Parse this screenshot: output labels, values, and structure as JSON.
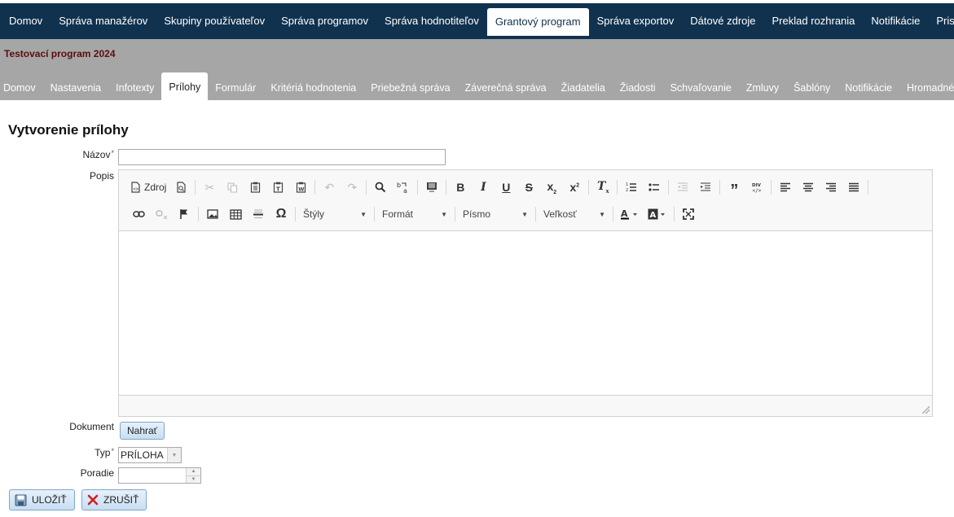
{
  "top_nav": {
    "items": [
      {
        "label": "Domov"
      },
      {
        "label": "Správa manažérov"
      },
      {
        "label": "Skupiny používateľov"
      },
      {
        "label": "Správa programov"
      },
      {
        "label": "Správa hodnotiteľov"
      },
      {
        "label": "Grantový program",
        "active": true
      },
      {
        "label": "Správa exportov"
      },
      {
        "label": "Dátové zdroje"
      },
      {
        "label": "Preklad rozhrania"
      },
      {
        "label": "Notifikácie"
      },
      {
        "label": "Prispôsobené texty"
      }
    ]
  },
  "program": {
    "title": "Testovací program 2024"
  },
  "sub_nav": {
    "items": [
      {
        "label": "Domov"
      },
      {
        "label": "Nastavenia"
      },
      {
        "label": "Infotexty"
      },
      {
        "label": "Prílohy",
        "active": true
      },
      {
        "label": "Formulár"
      },
      {
        "label": "Kritériá hodnotenia"
      },
      {
        "label": "Priebežná správa"
      },
      {
        "label": "Záverečná správa"
      },
      {
        "label": "Žiadatelia"
      },
      {
        "label": "Žiadosti"
      },
      {
        "label": "Schvaľovanie"
      },
      {
        "label": "Zmluvy"
      },
      {
        "label": "Šablóny"
      },
      {
        "label": "Notifikácie"
      },
      {
        "label": "Hromadné notifikácie"
      }
    ]
  },
  "page": {
    "title": "Vytvorenie prílohy"
  },
  "form": {
    "nazov_label": "Názov",
    "nazov_value": "",
    "popis_label": "Popis",
    "dokument_label": "Dokument",
    "upload_label": "Nahrať",
    "typ_label": "Typ",
    "typ_value": "PRÍLOHA",
    "poradie_label": "Poradie",
    "poradie_value": "",
    "required_mark": "*"
  },
  "editor": {
    "source_label": "Zdroj",
    "styles_label": "Štýly",
    "format_label": "Formát",
    "font_label": "Písmo",
    "size_label": "Veľkosť"
  },
  "actions": {
    "save_label": "ULOŽIŤ",
    "cancel_label": "ZRUŠIŤ"
  },
  "colors": {
    "top_nav_bg": "#10324f",
    "sub_nav_bg": "#a6a6a6",
    "program_title": "#5a0e0e",
    "cancel_icon": "#d42020"
  }
}
